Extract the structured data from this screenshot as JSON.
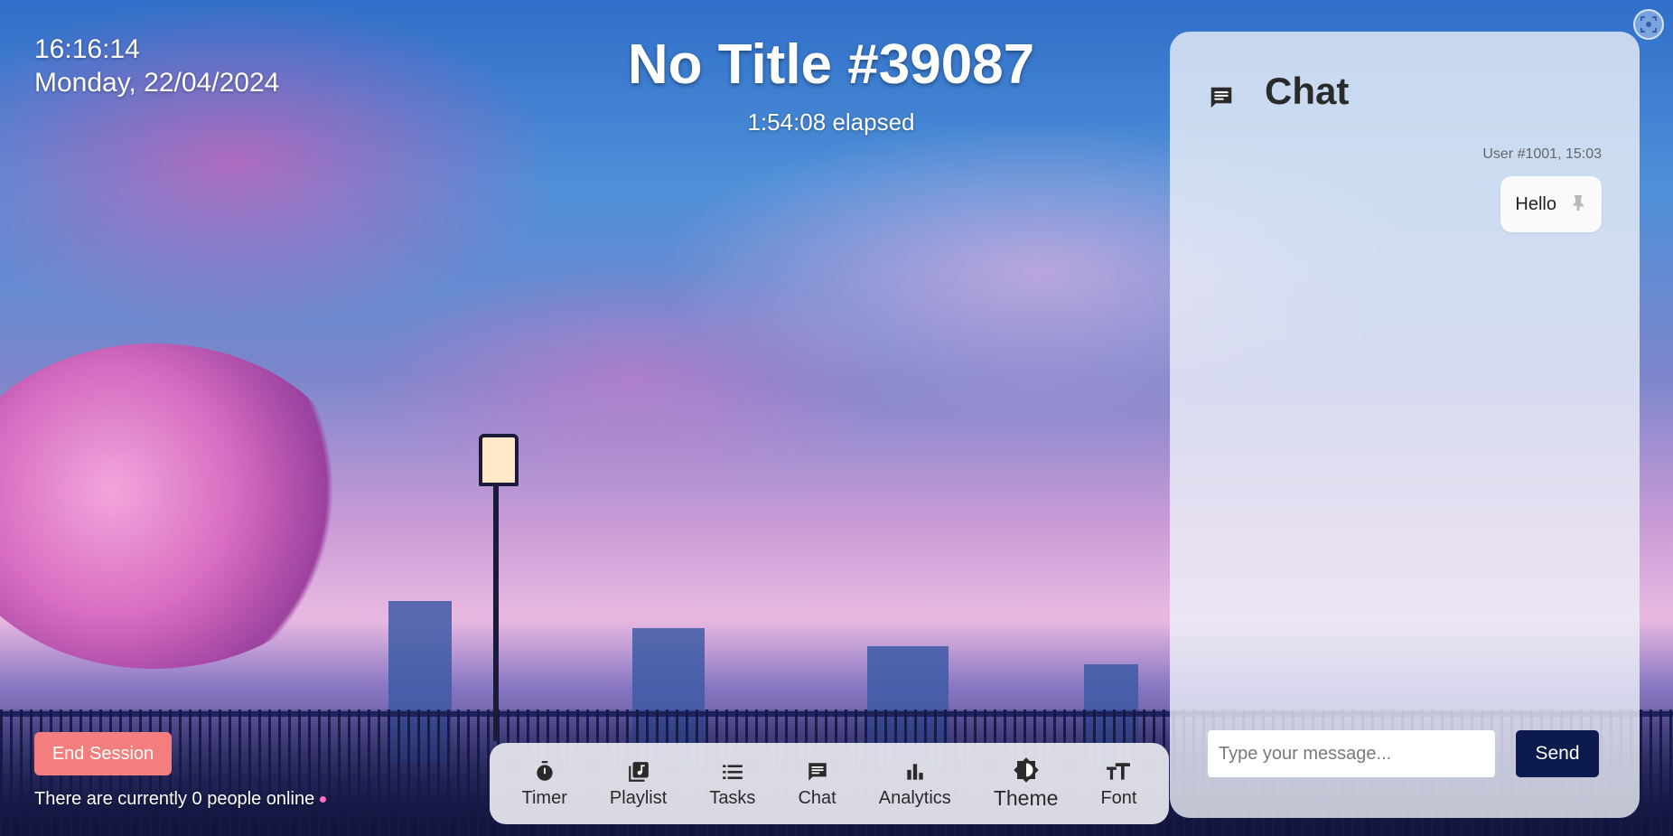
{
  "clock": {
    "time": "16:16:14",
    "date": "Monday, 22/04/2024"
  },
  "session": {
    "title": "No Title #39087",
    "elapsed": "1:54:08 elapsed"
  },
  "controls": {
    "end_session_label": "End Session"
  },
  "presence": {
    "online_text": "There are currently 0 people online"
  },
  "toolbar": {
    "items": [
      {
        "label": "Timer",
        "icon": "timer-icon"
      },
      {
        "label": "Playlist",
        "icon": "playlist-icon"
      },
      {
        "label": "Tasks",
        "icon": "tasks-icon"
      },
      {
        "label": "Chat",
        "icon": "chat-icon"
      },
      {
        "label": "Analytics",
        "icon": "analytics-icon"
      },
      {
        "label": "Theme",
        "icon": "theme-icon"
      },
      {
        "label": "Font",
        "icon": "font-icon"
      }
    ]
  },
  "chat": {
    "title": "Chat",
    "messages": [
      {
        "meta": "User #1001, 15:03",
        "text": "Hello",
        "pin_icon": "pin-icon"
      }
    ],
    "input_placeholder": "Type your message...",
    "send_label": "Send"
  },
  "colors": {
    "end_session": "#f47e7e",
    "send_button": "#0d1a4e",
    "online_dot": "#ff6ec7"
  }
}
